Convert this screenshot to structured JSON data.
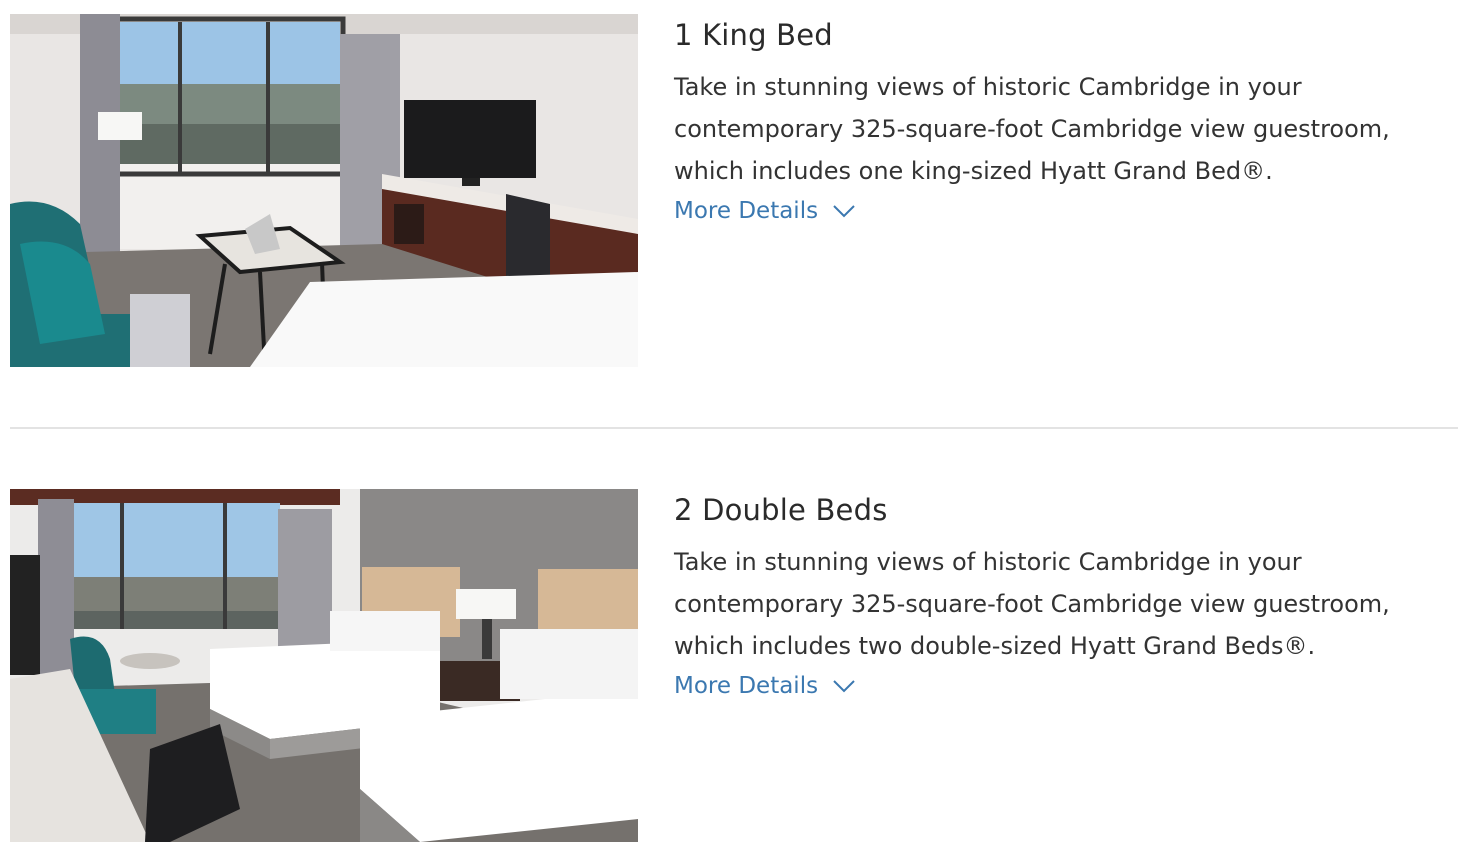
{
  "rooms": [
    {
      "title": "1 King Bed",
      "description": "Take in stunning views of historic Cambridge in your contemporary 325-square-foot Cambridge view guestroom, which includes one king-sized Hyatt Grand Bed®.",
      "more_details_label": "More Details",
      "photo_icon": "king-room-photo",
      "chevron_icon": "chevron-down-icon"
    },
    {
      "title": "2 Double Beds",
      "description": "Take in stunning views of historic Cambridge in your contemporary 325-square-foot Cambridge view guestroom, which includes two double-sized Hyatt Grand Beds®.",
      "more_details_label": "More Details",
      "photo_icon": "double-room-photo",
      "chevron_icon": "chevron-down-icon"
    }
  ],
  "colors": {
    "link": "#3b78b0",
    "text": "#333333",
    "divider": "#e3e3e3"
  }
}
